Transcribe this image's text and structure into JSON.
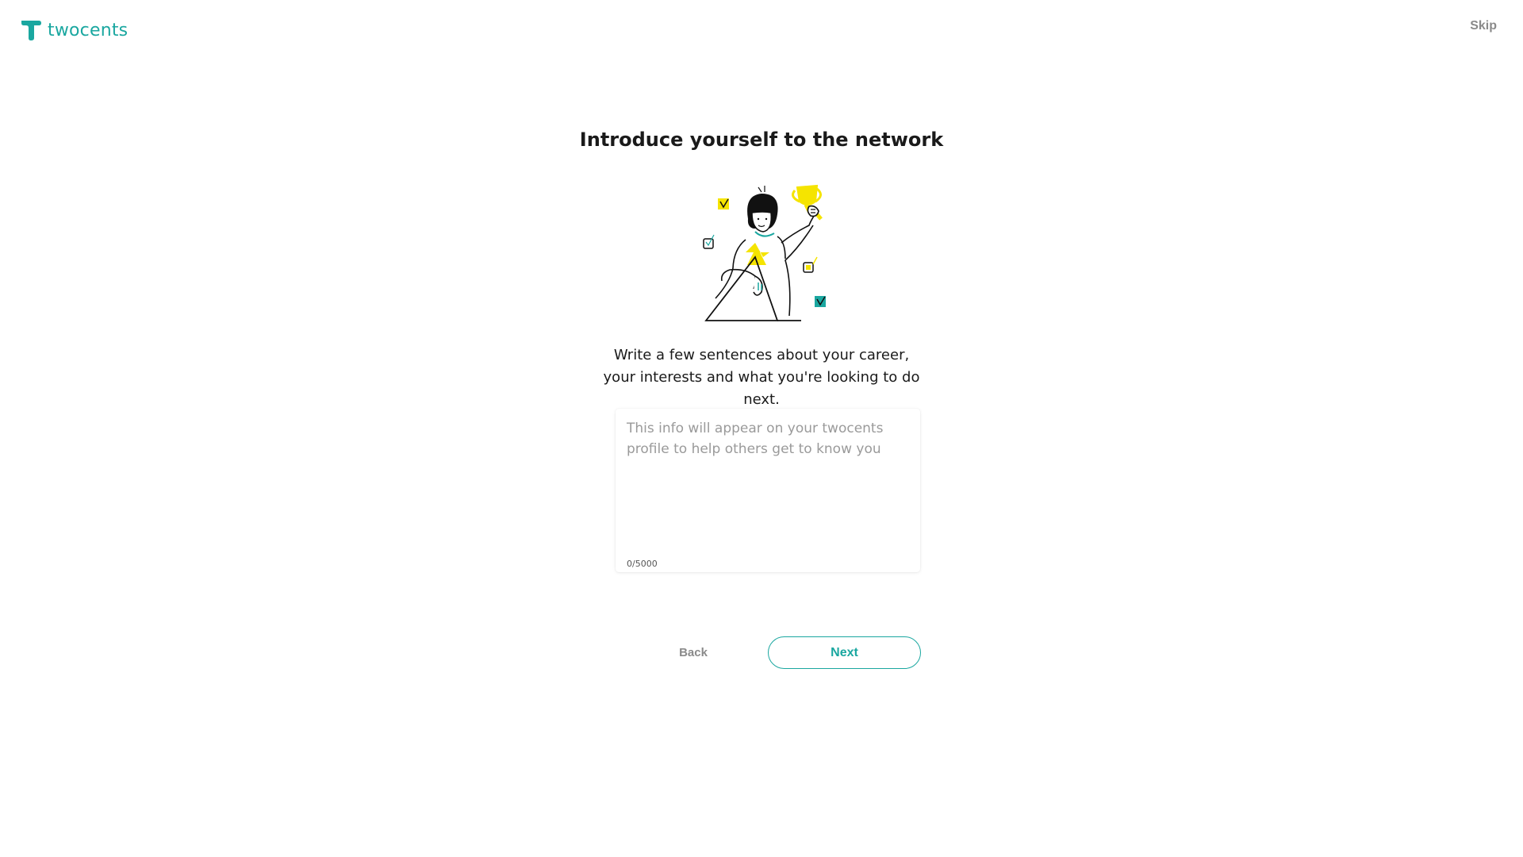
{
  "header": {
    "logo_text": "twocents",
    "skip_label": "Skip"
  },
  "main": {
    "title": "Introduce yourself to the network",
    "description": "Write a few sentences about your career, your interests and what you're looking to do next.",
    "bio": {
      "value": "",
      "placeholder": "This info will appear on your twocents profile to help others get to know you",
      "char_count": "0/5000"
    }
  },
  "actions": {
    "back_label": "Back",
    "next_label": "Next"
  },
  "colors": {
    "brand": "#1aa7a0",
    "accent_yellow": "#f5e400",
    "muted_text": "#8a8a8a"
  },
  "icons": {
    "logo": "twocents-logo-icon",
    "illustration": "person-holding-trophy-illustration"
  }
}
